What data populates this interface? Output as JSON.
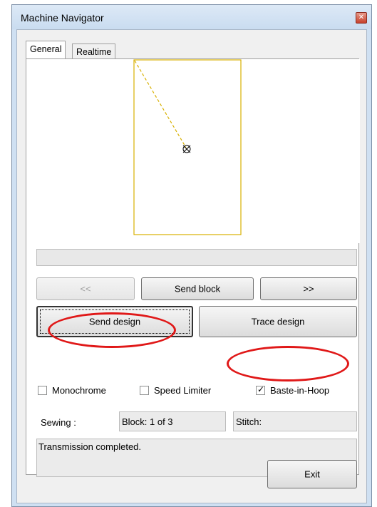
{
  "window": {
    "title": "Machine Navigator",
    "close_symbol": "✕"
  },
  "tabs": [
    {
      "label": "General",
      "active": true
    },
    {
      "label": "Realtime",
      "active": false
    }
  ],
  "preview": {
    "hoop_color": "#d8b000",
    "stitch_path_color": "#d8b000"
  },
  "navigation": {
    "prev_label": "<<",
    "send_block_label": "Send block",
    "next_label": ">>"
  },
  "actions": {
    "send_design_label": "Send design",
    "trace_design_label": "Trace design"
  },
  "options": {
    "monochrome": {
      "label": "Monochrome",
      "checked": false
    },
    "speed_limiter": {
      "label": "Speed Limiter",
      "checked": false
    },
    "baste_in_hoop": {
      "label": "Baste-in-Hoop",
      "checked": true
    }
  },
  "status": {
    "sewing_label": "Sewing :",
    "block_value": "Block: 1 of 3",
    "stitch_value": "Stitch:",
    "message": "Transmission completed."
  },
  "footer": {
    "exit_label": "Exit"
  },
  "annotation_color": "#e01818"
}
